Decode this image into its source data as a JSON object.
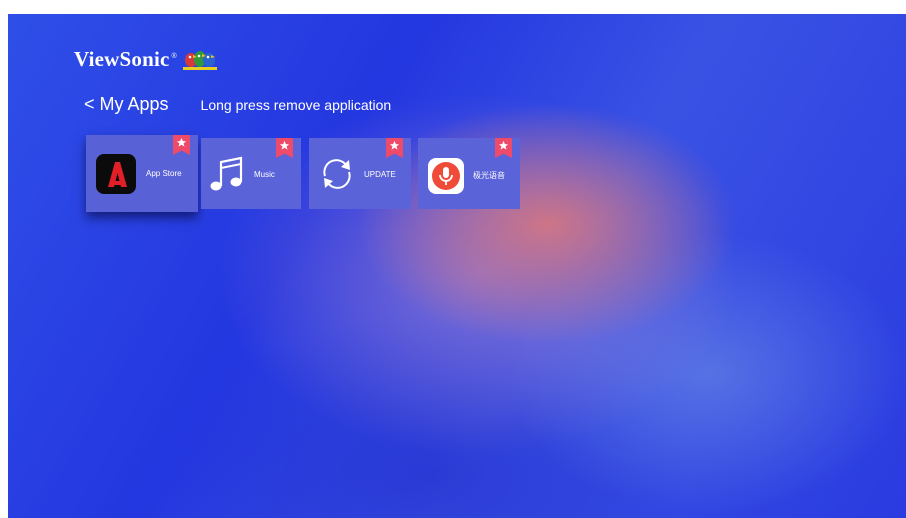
{
  "brand": {
    "name": "ViewSonic"
  },
  "nav": {
    "back_label": "< My Apps",
    "hint": "Long press remove application"
  },
  "apps": [
    {
      "label": "App Store",
      "icon": "app-store-icon"
    },
    {
      "label": "Music",
      "icon": "music-note-icon"
    },
    {
      "label": "UPDATE",
      "icon": "refresh-icon"
    },
    {
      "label": "极光语音",
      "icon": "microphone-icon"
    }
  ],
  "colors": {
    "tile": "#5a63d8",
    "badge": "#ee4a6a",
    "voice_icon": "#f04a38"
  }
}
